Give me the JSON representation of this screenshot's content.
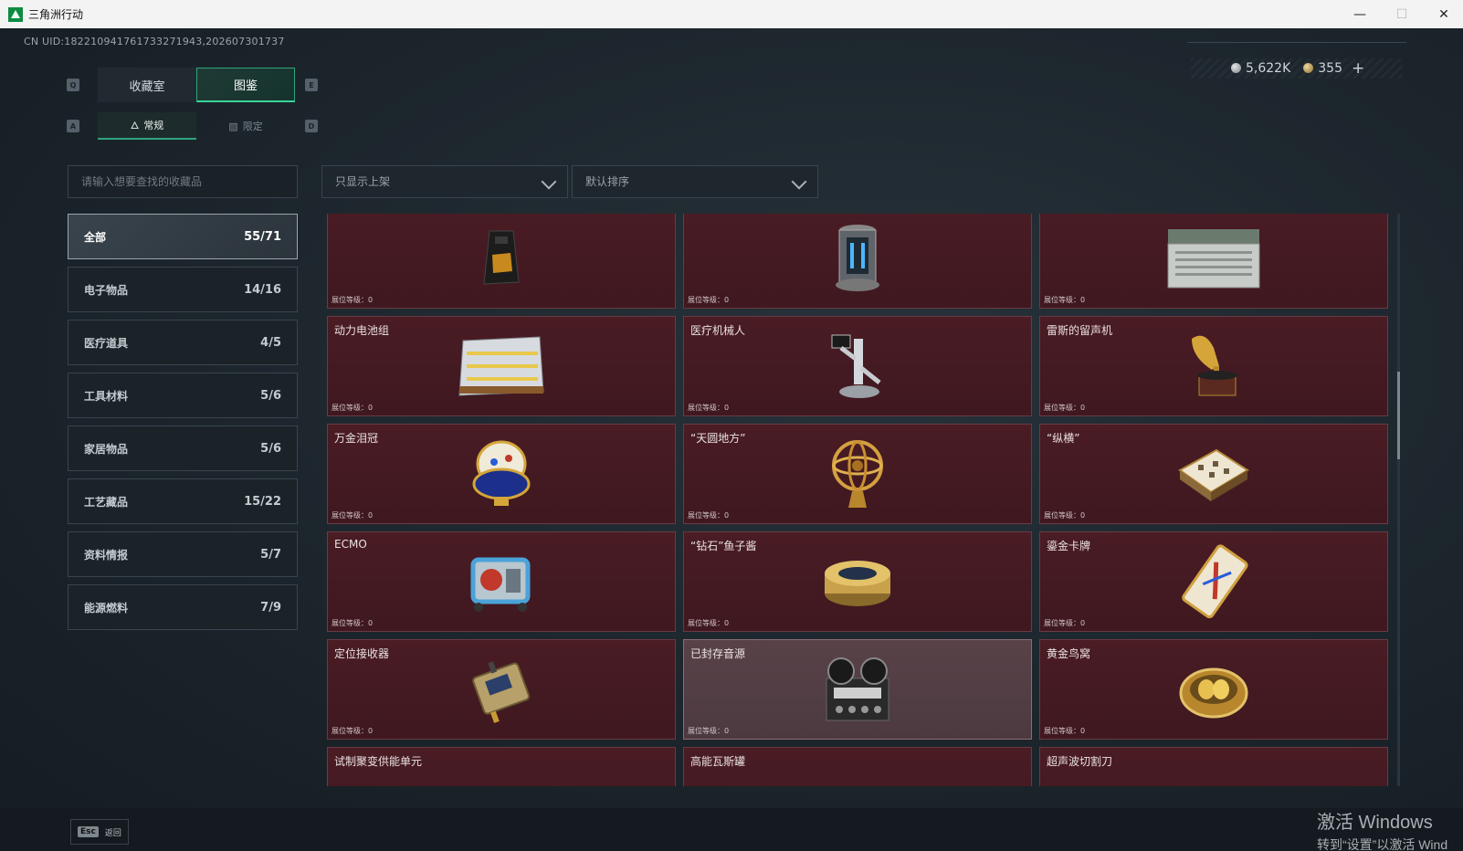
{
  "window": {
    "title": "三角洲行动",
    "min": "—",
    "max": "☐",
    "close": "✕"
  },
  "uid": "CN UID:182210941761733271943,202607301737",
  "currency": {
    "silver": "5,622K",
    "gold": "355",
    "plus": "+"
  },
  "keys": {
    "q": "Q",
    "e": "E",
    "a": "A",
    "d": "D"
  },
  "tabs": [
    "收藏室",
    "图鉴"
  ],
  "subtabs": [
    "常规",
    "限定"
  ],
  "search": {
    "placeholder": "请输入想要查找的收藏品"
  },
  "filters": {
    "shelf": "只显示上架",
    "sort": "默认排序"
  },
  "categories": [
    {
      "label": "全部",
      "count": "55/71"
    },
    {
      "label": "电子物品",
      "count": "14/16"
    },
    {
      "label": "医疗道具",
      "count": "4/5"
    },
    {
      "label": "工具材料",
      "count": "5/6"
    },
    {
      "label": "家居物品",
      "count": "5/6"
    },
    {
      "label": "工艺藏品",
      "count": "15/22"
    },
    {
      "label": "资料情报",
      "count": "5/7"
    },
    {
      "label": "能源燃料",
      "count": "7/9"
    }
  ],
  "level_label": "展位等级：0",
  "items": [
    {
      "name": "",
      "icon": "coffee-bag-icon"
    },
    {
      "name": "",
      "icon": "reactor-core-icon"
    },
    {
      "name": "",
      "icon": "server-crate-icon"
    },
    {
      "name": "动力电池组",
      "icon": "battery-pack-icon"
    },
    {
      "name": "医疗机械人",
      "icon": "medical-robot-icon"
    },
    {
      "name": "雷斯的留声机",
      "icon": "gramophone-icon"
    },
    {
      "name": "万金泪冠",
      "icon": "jeweled-egg-icon"
    },
    {
      "name": "“天圆地方”",
      "icon": "armillary-sphere-icon"
    },
    {
      "name": "“纵横”",
      "icon": "chess-set-icon"
    },
    {
      "name": "ECMO",
      "icon": "ecmo-machine-icon"
    },
    {
      "name": "“钻石”鱼子酱",
      "icon": "caviar-tin-icon"
    },
    {
      "name": "鎏金卡牌",
      "icon": "gilded-card-icon"
    },
    {
      "name": "定位接收器",
      "icon": "gps-receiver-icon"
    },
    {
      "name": "已封存音源",
      "icon": "reel-recorder-icon"
    },
    {
      "name": "黄金鸟窝",
      "icon": "golden-nest-icon"
    },
    {
      "name": "试制聚变供能单元",
      "icon": "fusion-unit-icon"
    },
    {
      "name": "高能瓦斯罐",
      "icon": "gas-tank-icon"
    },
    {
      "name": "超声波切割刀",
      "icon": "ultrasonic-cutter-icon"
    }
  ],
  "back": {
    "key": "Esc",
    "label": "返回"
  },
  "watermark": {
    "line1": "激活 Windows",
    "line2": "转到“设置”以激活 Wind"
  }
}
